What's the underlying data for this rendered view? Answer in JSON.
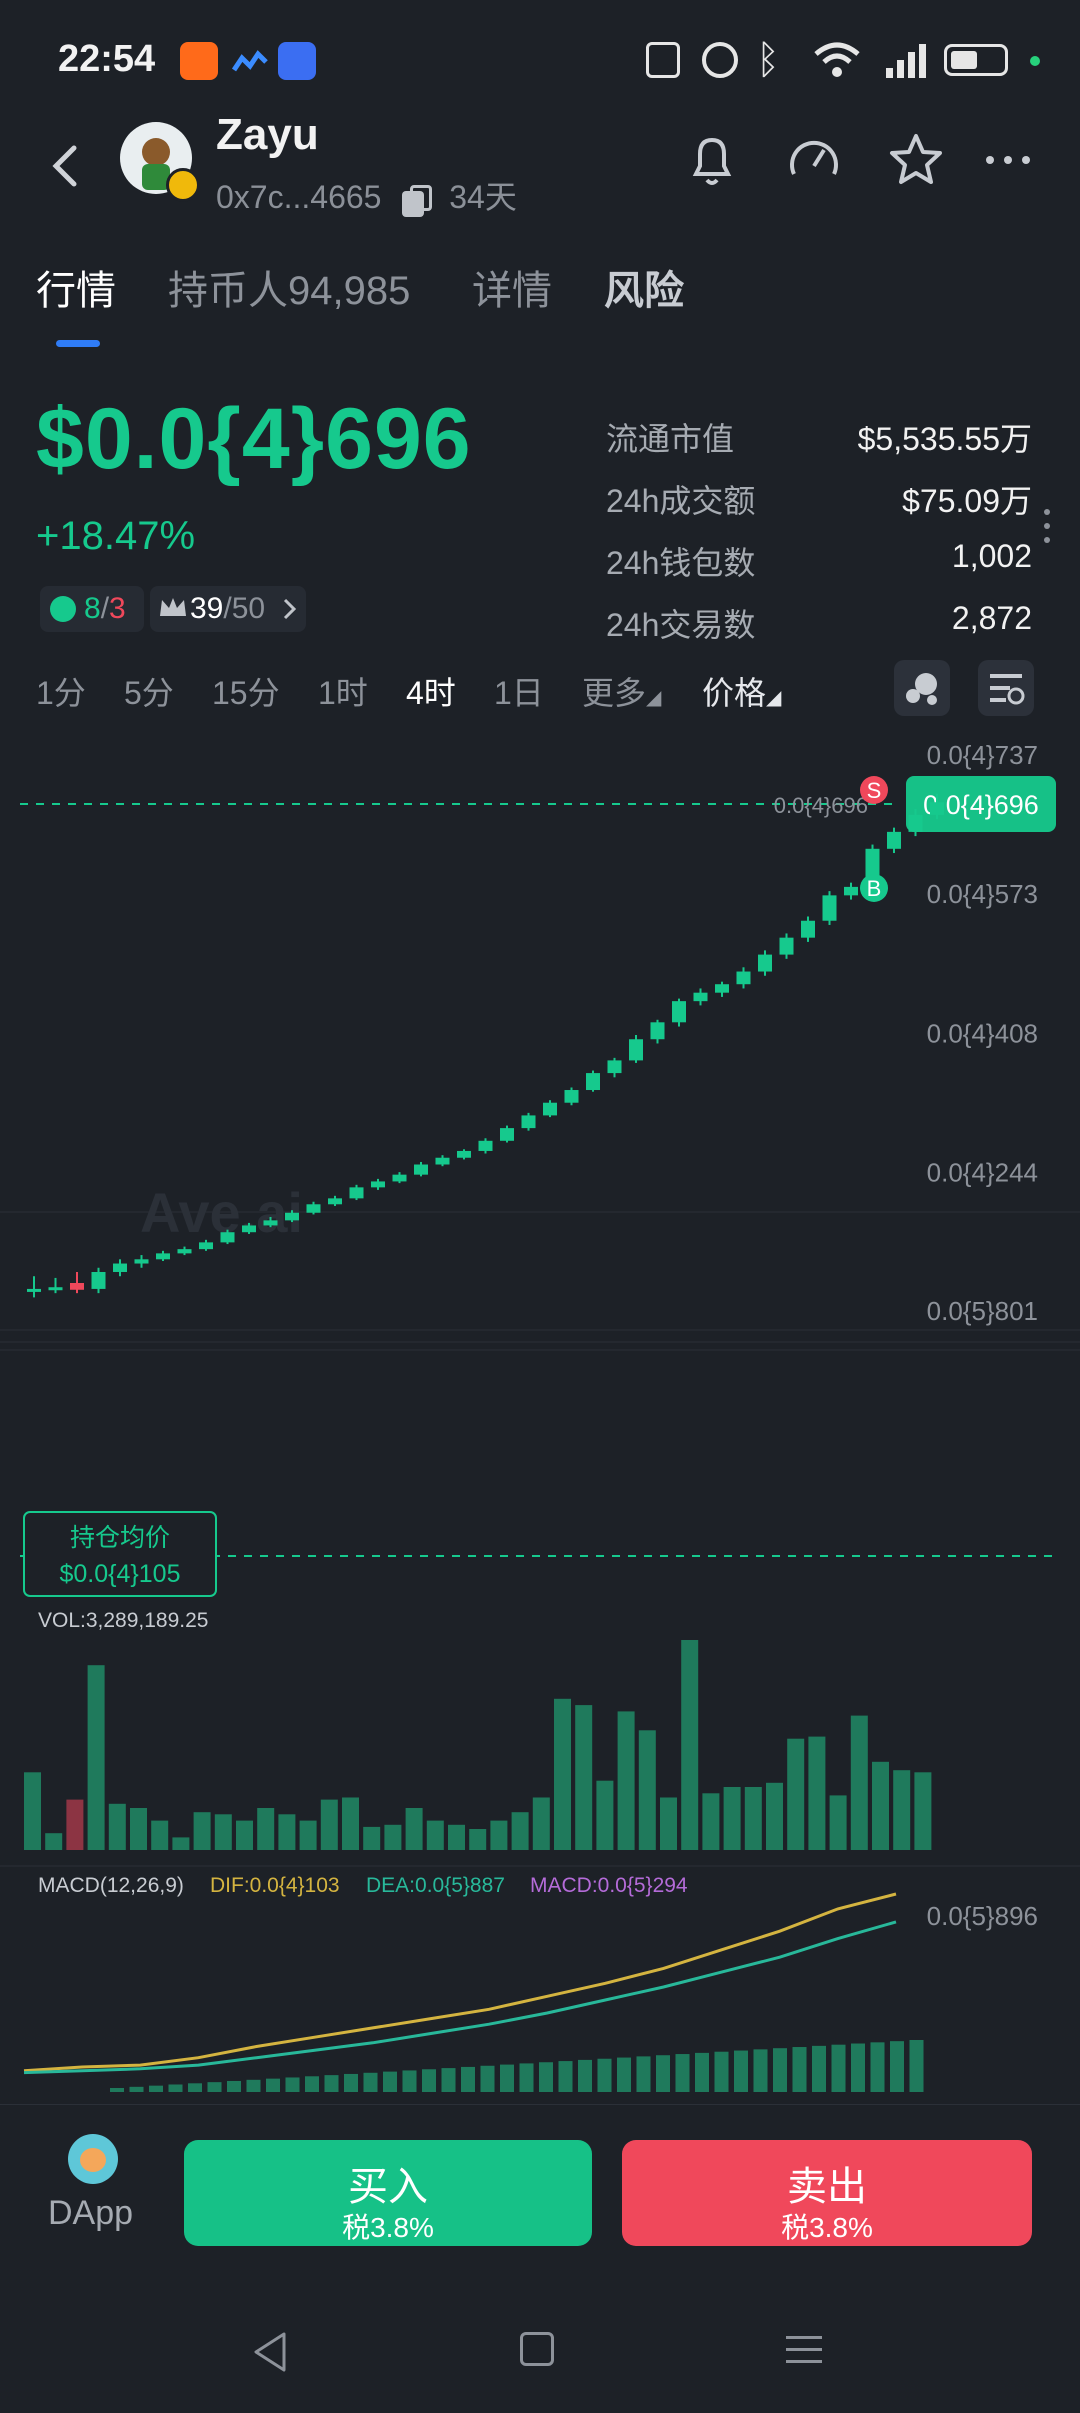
{
  "status_bar": {
    "time": "22:54"
  },
  "header": {
    "token_name": "Zayu",
    "address": "0x7c...4665",
    "age": "34天"
  },
  "tabs": [
    {
      "label": "行情",
      "active": true
    },
    {
      "label": "持币人94,985",
      "active": false
    },
    {
      "label": "详情",
      "active": false
    },
    {
      "label": "风险",
      "active": false
    }
  ],
  "price": {
    "value": "$0.0{4}696",
    "change": "+18.47%"
  },
  "badges": {
    "smart_buy": "8",
    "smart_sell": "3",
    "top_holders": "39",
    "top_total": "/50"
  },
  "stats": [
    {
      "label": "流通市值",
      "value": "$5,535.55万"
    },
    {
      "label": "24h成交额",
      "value": "$75.09万"
    },
    {
      "label": "24h钱包数",
      "value": "1,002"
    },
    {
      "label": "24h交易数",
      "value": "2,872"
    }
  ],
  "intervals": [
    {
      "label": "1分",
      "active": false
    },
    {
      "label": "5分",
      "active": false
    },
    {
      "label": "15分",
      "active": false
    },
    {
      "label": "1时",
      "active": false
    },
    {
      "label": "4时",
      "active": true
    },
    {
      "label": "1日",
      "active": false
    },
    {
      "label": "更多",
      "active": false
    },
    {
      "label": "价格",
      "active": false
    }
  ],
  "chart": {
    "y_labels": [
      "0.0{4}737",
      "0.0{4}573",
      "0.0{4}408",
      "0.0{4}244",
      "0.0{5}801"
    ],
    "current_price_tag": "0.0{4}696",
    "last_line_label": "0.0{4}696",
    "sell_marker": "S",
    "buy_marker": "B",
    "avg_cost_title": "持仓均价",
    "avg_cost_value": "$0.0{4}105",
    "watermark": "Ave.ai",
    "vol_label": "VOL:3,289,189.25",
    "macd_label": "MACD(12,26,9)",
    "dif_label": "DIF:0.0{4}103",
    "dea_label": "DEA:0.0{5}887",
    "macd_value_label": "MACD:0.0{5}294",
    "macd_axis_label": "0.0{5}896",
    "colors": {
      "up": "#16c98d",
      "down": "#f0485b",
      "dif": "#d4b440",
      "dea": "#28b89a",
      "macd": "#b46bd8"
    }
  },
  "chart_data": {
    "type": "candlestick",
    "price_unit": "1e-4 USD",
    "ylim": [
      0.0801,
      0.0737
    ],
    "y_ticks": [
      0.0801,
      0.244,
      0.408,
      0.573,
      0.737
    ],
    "candles": [
      {
        "o": 0.105,
        "c": 0.105,
        "h": 0.12,
        "l": 0.095
      },
      {
        "o": 0.106,
        "c": 0.107,
        "h": 0.118,
        "l": 0.1
      },
      {
        "o": 0.112,
        "c": 0.104,
        "h": 0.125,
        "l": 0.1
      },
      {
        "o": 0.105,
        "c": 0.125,
        "h": 0.13,
        "l": 0.1
      },
      {
        "o": 0.125,
        "c": 0.135,
        "h": 0.14,
        "l": 0.12
      },
      {
        "o": 0.135,
        "c": 0.14,
        "h": 0.145,
        "l": 0.13
      },
      {
        "o": 0.14,
        "c": 0.147,
        "h": 0.15,
        "l": 0.138
      },
      {
        "o": 0.147,
        "c": 0.152,
        "h": 0.155,
        "l": 0.145
      },
      {
        "o": 0.152,
        "c": 0.16,
        "h": 0.163,
        "l": 0.15
      },
      {
        "o": 0.16,
        "c": 0.172,
        "h": 0.175,
        "l": 0.158
      },
      {
        "o": 0.172,
        "c": 0.18,
        "h": 0.183,
        "l": 0.17
      },
      {
        "o": 0.18,
        "c": 0.186,
        "h": 0.19,
        "l": 0.178
      },
      {
        "o": 0.186,
        "c": 0.195,
        "h": 0.198,
        "l": 0.184
      },
      {
        "o": 0.195,
        "c": 0.205,
        "h": 0.208,
        "l": 0.193
      },
      {
        "o": 0.205,
        "c": 0.212,
        "h": 0.215,
        "l": 0.203
      },
      {
        "o": 0.212,
        "c": 0.225,
        "h": 0.228,
        "l": 0.21
      },
      {
        "o": 0.225,
        "c": 0.232,
        "h": 0.235,
        "l": 0.222
      },
      {
        "o": 0.232,
        "c": 0.24,
        "h": 0.243,
        "l": 0.23
      },
      {
        "o": 0.24,
        "c": 0.252,
        "h": 0.255,
        "l": 0.238
      },
      {
        "o": 0.252,
        "c": 0.26,
        "h": 0.263,
        "l": 0.25
      },
      {
        "o": 0.26,
        "c": 0.268,
        "h": 0.27,
        "l": 0.258
      },
      {
        "o": 0.268,
        "c": 0.28,
        "h": 0.283,
        "l": 0.265
      },
      {
        "o": 0.28,
        "c": 0.295,
        "h": 0.298,
        "l": 0.278
      },
      {
        "o": 0.295,
        "c": 0.31,
        "h": 0.313,
        "l": 0.292
      },
      {
        "o": 0.31,
        "c": 0.325,
        "h": 0.328,
        "l": 0.308
      },
      {
        "o": 0.325,
        "c": 0.34,
        "h": 0.343,
        "l": 0.322
      },
      {
        "o": 0.34,
        "c": 0.36,
        "h": 0.363,
        "l": 0.338
      },
      {
        "o": 0.36,
        "c": 0.375,
        "h": 0.378,
        "l": 0.355
      },
      {
        "o": 0.375,
        "c": 0.4,
        "h": 0.405,
        "l": 0.372
      },
      {
        "o": 0.4,
        "c": 0.42,
        "h": 0.423,
        "l": 0.395
      },
      {
        "o": 0.42,
        "c": 0.445,
        "h": 0.448,
        "l": 0.415
      },
      {
        "o": 0.445,
        "c": 0.455,
        "h": 0.46,
        "l": 0.44
      },
      {
        "o": 0.455,
        "c": 0.465,
        "h": 0.468,
        "l": 0.45
      },
      {
        "o": 0.465,
        "c": 0.48,
        "h": 0.485,
        "l": 0.46
      },
      {
        "o": 0.48,
        "c": 0.5,
        "h": 0.505,
        "l": 0.475
      },
      {
        "o": 0.5,
        "c": 0.52,
        "h": 0.525,
        "l": 0.495
      },
      {
        "o": 0.52,
        "c": 0.54,
        "h": 0.545,
        "l": 0.515
      },
      {
        "o": 0.54,
        "c": 0.57,
        "h": 0.575,
        "l": 0.535
      },
      {
        "o": 0.57,
        "c": 0.58,
        "h": 0.585,
        "l": 0.565
      },
      {
        "o": 0.58,
        "c": 0.625,
        "h": 0.63,
        "l": 0.575
      },
      {
        "o": 0.625,
        "c": 0.645,
        "h": 0.65,
        "l": 0.62
      },
      {
        "o": 0.645,
        "c": 0.665,
        "h": 0.672,
        "l": 0.64
      },
      {
        "o": 0.665,
        "c": 0.68,
        "h": 0.69,
        "l": 0.66
      }
    ],
    "volume": [
      0.37,
      0.08,
      0.24,
      0.88,
      0.22,
      0.2,
      0.14,
      0.06,
      0.18,
      0.17,
      0.14,
      0.2,
      0.17,
      0.14,
      0.24,
      0.25,
      0.11,
      0.12,
      0.2,
      0.14,
      0.12,
      0.1,
      0.14,
      0.18,
      0.25,
      0.72,
      0.69,
      0.33,
      0.66,
      0.57,
      0.25,
      1.0,
      0.27,
      0.3,
      0.3,
      0.32,
      0.53,
      0.54,
      0.26,
      0.64,
      0.42,
      0.38,
      0.37
    ],
    "dif_curve_norm": [
      0.05,
      0.07,
      0.08,
      0.12,
      0.18,
      0.23,
      0.28,
      0.33,
      0.38,
      0.45,
      0.52,
      0.6,
      0.7,
      0.8,
      0.92,
      1.0
    ],
    "dea_curve_norm": [
      0.04,
      0.05,
      0.06,
      0.08,
      0.12,
      0.16,
      0.2,
      0.25,
      0.3,
      0.36,
      0.43,
      0.5,
      0.58,
      0.66,
      0.76,
      0.85
    ]
  },
  "bottom": {
    "dapp_label": "DApp",
    "buy_label": "买入",
    "buy_tax": "税3.8%",
    "sell_label": "卖出",
    "sell_tax": "税3.8%"
  }
}
